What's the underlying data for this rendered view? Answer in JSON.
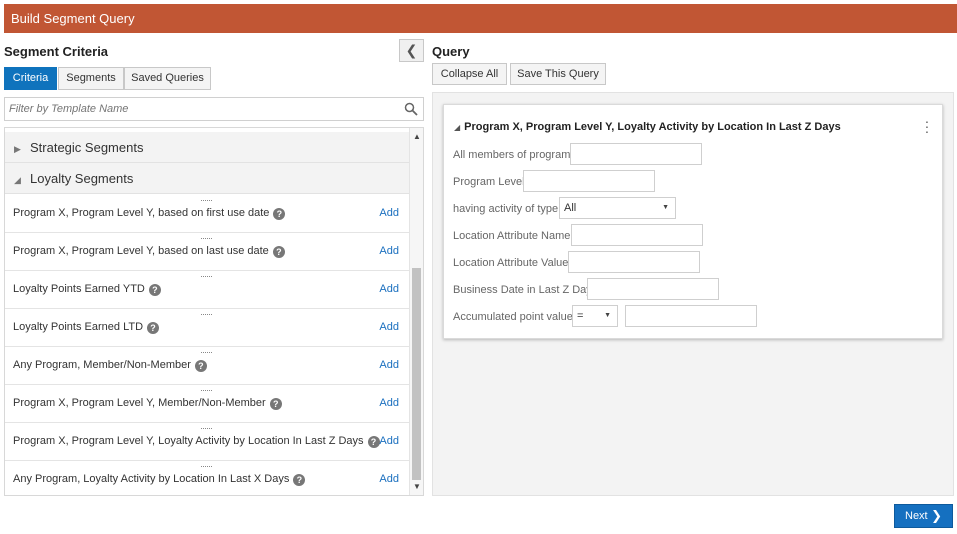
{
  "window": {
    "title": "Build Segment Query"
  },
  "left": {
    "heading": "Segment Criteria",
    "tabs": [
      {
        "label": "Criteria",
        "active": true
      },
      {
        "label": "Segments",
        "active": false
      },
      {
        "label": "Saved Queries",
        "active": false
      }
    ],
    "filter": {
      "placeholder": "Filter by Template Name",
      "value": ""
    },
    "groups": [
      {
        "label": "Strategic Segments",
        "expanded": false
      },
      {
        "label": "Loyalty Segments",
        "expanded": true
      }
    ],
    "items": [
      {
        "label": "Program X, Program Level Y, based on first use date",
        "action": "Add"
      },
      {
        "label": "Program X, Program Level Y, based on last use date",
        "action": "Add"
      },
      {
        "label": "Loyalty Points Earned YTD",
        "action": "Add"
      },
      {
        "label": "Loyalty Points Earned LTD",
        "action": "Add"
      },
      {
        "label": "Any Program, Member/Non-Member",
        "action": "Add"
      },
      {
        "label": "Program X, Program Level Y, Member/Non-Member",
        "action": "Add"
      },
      {
        "label": "Program X, Program Level Y, Loyalty Activity by Location In Last Z Days",
        "action": "Add"
      },
      {
        "label": "Any Program, Loyalty Activity by Location In Last X Days",
        "action": "Add"
      }
    ]
  },
  "right": {
    "heading": "Query",
    "buttons": {
      "collapse_all": "Collapse All",
      "save": "Save This Query"
    },
    "card": {
      "title": "Program X, Program Level Y, Loyalty Activity by Location In Last Z Days",
      "fields": [
        {
          "label": "All members of program",
          "type": "input",
          "value": ""
        },
        {
          "label": "Program Level",
          "type": "input",
          "value": ""
        },
        {
          "label": "having activity of type",
          "type": "select",
          "value": "All"
        },
        {
          "label": "Location Attribute Name",
          "type": "input",
          "value": ""
        },
        {
          "label": "Location Attribute Value",
          "type": "input",
          "value": ""
        },
        {
          "label": "Business Date in Last Z Days",
          "type": "input",
          "value": ""
        },
        {
          "label": "Accumulated point value",
          "type": "select+input",
          "value": "=",
          "value2": ""
        }
      ]
    }
  },
  "footer": {
    "next_label": "Next"
  },
  "colors": {
    "titlebar": "#c15634",
    "accent": "#0f73bd",
    "link": "#1a6fbf"
  }
}
